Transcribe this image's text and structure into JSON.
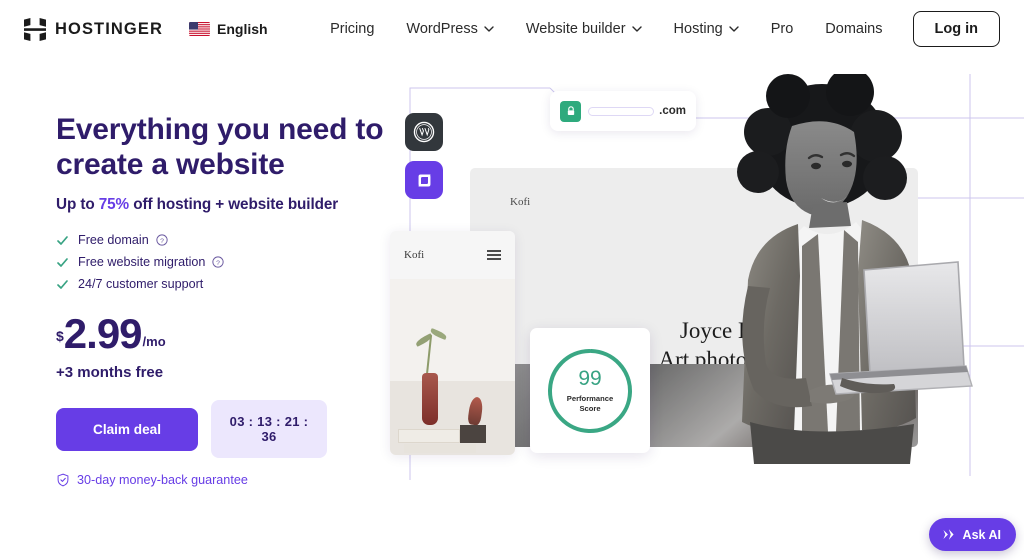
{
  "header": {
    "logo_word": "HOSTINGER",
    "logo_icon": "hostinger-h-logo",
    "language": {
      "label": "English",
      "flag_icon": "us-flag-icon"
    },
    "nav": [
      {
        "label": "Pricing",
        "has_chevron": false
      },
      {
        "label": "WordPress",
        "has_chevron": true
      },
      {
        "label": "Website builder",
        "has_chevron": true
      },
      {
        "label": "Hosting",
        "has_chevron": true
      },
      {
        "label": "Pro",
        "has_chevron": false
      },
      {
        "label": "Domains",
        "has_chevron": false
      }
    ],
    "login_label": "Log in"
  },
  "hero": {
    "heading_line1": "Everything you need to",
    "heading_line2": "create a website",
    "sub_prefix": "Up to ",
    "sub_percent": "75%",
    "sub_suffix": " off hosting + website builder",
    "features": [
      {
        "label": "Free domain",
        "help": true
      },
      {
        "label": "Free website migration",
        "help": true
      },
      {
        "label": "24/7 customer support",
        "help": false
      }
    ],
    "price": {
      "currency": "$",
      "amount": "2.99",
      "period": "/mo"
    },
    "months_free": "+3 months free",
    "claim_label": "Claim deal",
    "timer": "03 : 13 : 21 : 36",
    "guarantee": "30-day money-back guarantee",
    "guarantee_icon": "shield-check-icon"
  },
  "art": {
    "url_suffix": ".com",
    "lock_icon": "padlock-icon",
    "app_icons": [
      {
        "name": "wordpress-icon"
      },
      {
        "name": "hostinger-builder-icon"
      }
    ],
    "desktop_preview": {
      "brand": "Kofi",
      "title_line1": "Joyce Beale,",
      "title_line2": "Art photographer"
    },
    "mobile_preview": {
      "brand": "Kofi",
      "menu_icon": "hamburger-icon"
    },
    "performance": {
      "score": "99",
      "label_line1": "Performance",
      "label_line2": "Score"
    }
  },
  "ask_ai": {
    "label": "Ask AI",
    "icon": "sparkle-plane-icon"
  },
  "colors": {
    "brand_purple": "#673de6",
    "heading_purple": "#2f1c6a",
    "timer_bg": "#ece7fd",
    "green": "#38a383",
    "lock_green": "#2eaa7d"
  }
}
